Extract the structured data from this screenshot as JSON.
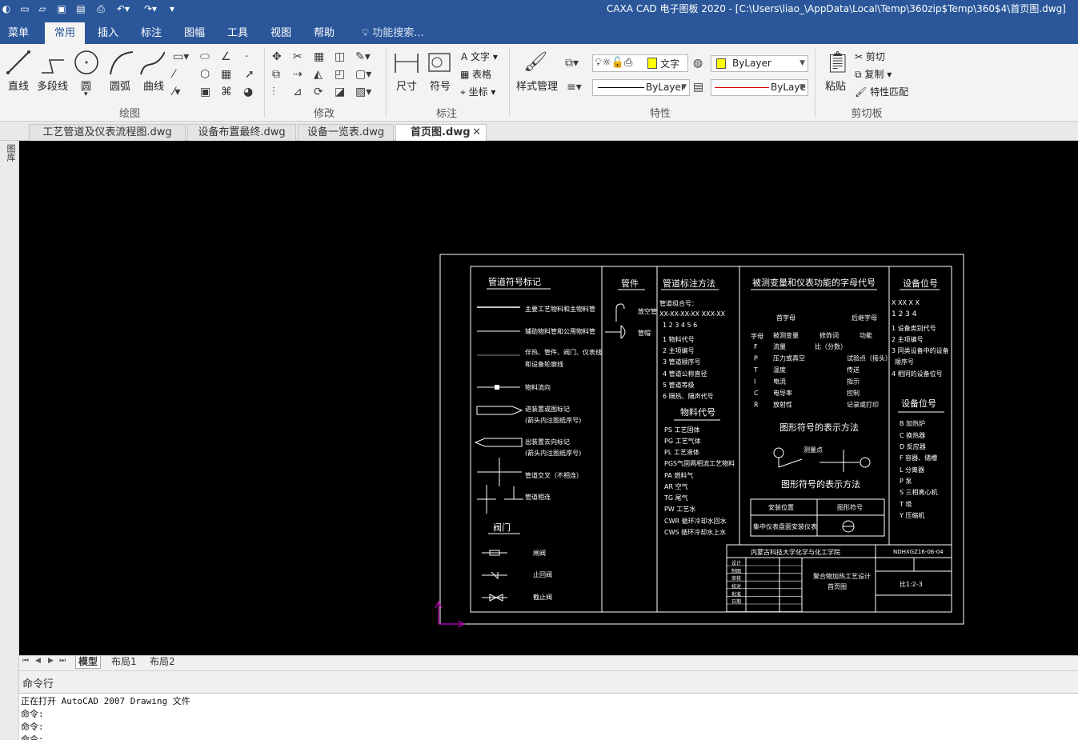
{
  "titlebar": {
    "title": "CAXA CAD 电子图板 2020 - [C:\\Users\\liao_\\AppData\\Local\\Temp\\360zip$Temp\\360$4\\首页图.dwg]",
    "quick_access": [
      "new-icon",
      "open-icon",
      "save-icon",
      "save-as-icon",
      "print-icon",
      "undo-icon",
      "redo-icon",
      "customize-icon"
    ]
  },
  "menu": {
    "tabs": [
      "菜单",
      "常用",
      "插入",
      "标注",
      "图幅",
      "工具",
      "视图",
      "帮助"
    ],
    "active": "常用",
    "search_placeholder": "功能搜索..."
  },
  "ribbon": {
    "draw": {
      "group_label": "绘图",
      "line": "直线",
      "polyline": "多段线",
      "circle": "圆",
      "arc": "圆弧",
      "curve": "曲线"
    },
    "modify": {
      "group_label": "修改"
    },
    "annotate": {
      "group_label": "标注",
      "dimension": "尺寸",
      "symbol": "符号",
      "text": "文字",
      "table": "表格",
      "coordinate": "坐标"
    },
    "properties": {
      "group_label": "特性",
      "style_manager": "样式管理",
      "text_style": "文字",
      "color_value": "ByLayer",
      "linetype_value": "ByLayer",
      "lineweight_value": "ByLaye",
      "layer_color": "#ffff00"
    },
    "clipboard": {
      "group_label": "剪切板",
      "paste": "粘贴",
      "cut": "剪切",
      "copy": "复制",
      "match": "特性匹配"
    }
  },
  "doc_tabs": [
    "工艺管道及仪表流程图.dwg",
    "设备布置最终.dwg",
    "设备一览表.dwg",
    "首页图.dwg"
  ],
  "active_doc": "首页图.dwg",
  "left_panel_label": "图库",
  "layout_tabs": [
    "模型",
    "布局1",
    "布局2"
  ],
  "active_layout": "模型",
  "command": {
    "header": "命令行",
    "lines": [
      "正在打开 AutoCAD 2007 Drawing 文件",
      "命令:",
      "命令:",
      "命令:"
    ]
  },
  "drawing": {
    "sec1_title": "管道符号标记",
    "sec1_items": [
      "主要工艺物料和主物料管",
      "辅助物料管和公用物料管",
      "伴热、管件、阀门、仪表线",
      "和设备轮廓线",
      "物料流向",
      "进装置或图标记",
      "(箭头内注图纸序号)",
      "出装置去向标记",
      "(箭头内注图纸序号)",
      "管道交叉（不相连）",
      "管道相连"
    ],
    "valve_title": "阀门",
    "valve_items": [
      "闸阀",
      "止回阀",
      "截止阀"
    ],
    "sec2_title": "管件",
    "sec2_items": [
      "放空管",
      "管帽"
    ],
    "sec3_title": "管道标注方法",
    "sec3_lines": [
      "管道组合号：",
      "XX-XX-XX-XX XXX-XX",
      "1 2 3 4 5 6",
      "1 物料代号",
      "2 主项编号",
      "3 管道顺序号",
      "4 管道公称直径",
      "5 管道等级",
      "6 隔热、隔声代号"
    ],
    "mat_title": "物料代号",
    "mat_lines": [
      "PS 工艺固体",
      "PG 工艺气体",
      "PL 工艺液体",
      "PGS气固两相流工艺物料",
      "PA 燃料气",
      "AR 空气",
      "TG 尾气",
      "PW 工艺水",
      "CWR 循环冷却水回水",
      "CWS 循环冷却水上水"
    ],
    "sec4_title": "被测变量和仪表功能的字母代号",
    "sec4_head": [
      "首字母",
      "后继字母"
    ],
    "sec4_cols": [
      "字母",
      "被测变量",
      "修饰词",
      "功能"
    ],
    "sec4_rows": [
      [
        "F",
        "流量",
        "比（分数）",
        ""
      ],
      [
        "P",
        "压力或真空",
        "",
        "试验点（接头）"
      ],
      [
        "T",
        "温度",
        "",
        "传送"
      ],
      [
        "I",
        "电流",
        "",
        "指示"
      ],
      [
        "C",
        "电导率",
        "",
        "控制"
      ],
      [
        "R",
        "放射性",
        "",
        "记录或打印"
      ]
    ],
    "inst_title": "图形符号的表示方法",
    "inst_label": "测量点",
    "sym_title": "图形符号的表示方法",
    "sym_table": [
      "安装位置",
      "图形符号",
      "集中仪表盘面安装仪表"
    ],
    "sec5_title": "设备位号",
    "sec5_lines": [
      "X XX X X",
      "1 2 3 4",
      "1 设备类别代号",
      "2 主项编号",
      "3 同类设备中的设备",
      "顺序号",
      "4 相同的设备位号"
    ],
    "sec6_title": "设备位号",
    "sec6_lines": [
      "B 加热炉",
      "C 换热器",
      "D 反应器",
      "F 容器、储槽",
      "L 分离器",
      "P 泵",
      "S 三相离心机",
      "T 塔",
      "Y 压缩机"
    ],
    "titleblock": {
      "school": "内蒙古科技大学化学与化工学院",
      "code": "NDHXGZ16-06-04",
      "project": "聚合物加热工艺设计",
      "sheet": "首页图",
      "scale": "比1:2-3",
      "roles": [
        "设计",
        "制图",
        "审核",
        "校对",
        "批准",
        "日期"
      ]
    }
  }
}
